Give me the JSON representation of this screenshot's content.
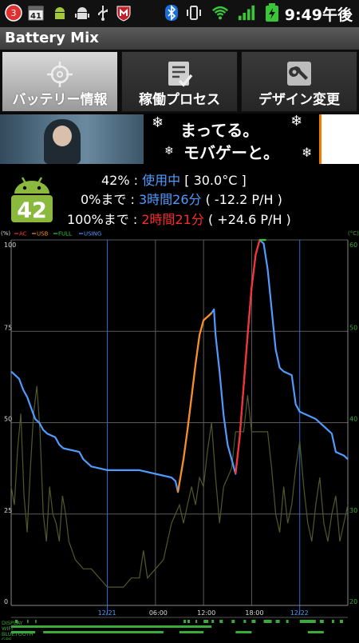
{
  "status_bar": {
    "time": "9:49午後",
    "notification_count": "3",
    "calendar_day": "41",
    "icons": [
      "notification-badge",
      "calendar",
      "android-robot",
      "android-robot",
      "usb",
      "mcafee-shield",
      "bluetooth",
      "vibrate",
      "wifi",
      "signal-bars",
      "battery-charging"
    ]
  },
  "app": {
    "title": "Battery Mix"
  },
  "tabs": [
    {
      "label": "バッテリー情報",
      "icon": "crosshair-icon",
      "active": true
    },
    {
      "label": "稼働プロセス",
      "icon": "checklist-icon",
      "active": false
    },
    {
      "label": "デザイン変更",
      "icon": "wrench-icon",
      "active": false
    }
  ],
  "banner": {
    "line1": "まってる。",
    "line2": "モバゲーと。"
  },
  "battery": {
    "level": "42",
    "percent_text": "42%",
    "sep": " : ",
    "status": "使用中",
    "temp": "[ 30.0°C ]",
    "to_empty_label": "0%まで",
    "to_empty_time": "3時間26分",
    "to_empty_rate": "( -12.2 P/H )",
    "to_full_label": "100%まで",
    "to_full_time": "2時間21分",
    "to_full_rate": "( +24.6 P/H )"
  },
  "colors": {
    "blue": "#4f9bff",
    "red": "#ff2b2b",
    "orange": "#ff8c1a",
    "green": "#5cd05c",
    "temp_line": "#4f5a2a",
    "android_green": "#8ab93d"
  },
  "chart_data": {
    "type": "line",
    "legend": [
      "AC",
      "USB",
      "FULL",
      "USING"
    ],
    "legend_colors": [
      "#ff3030",
      "#ff8c1a",
      "#33cc33",
      "#4f9bff"
    ],
    "left_axis": {
      "label": "(%)",
      "ticks": [
        "100",
        "75",
        "50",
        "25",
        "0"
      ],
      "range": [
        0,
        100
      ]
    },
    "right_axis": {
      "label": "(°C)",
      "ticks": [
        "60",
        "50",
        "40",
        "30",
        "20"
      ],
      "range": [
        20,
        60
      ]
    },
    "x_labels": [
      "12/21",
      "06:00",
      "12:00",
      "18:00",
      "12/22"
    ],
    "x_range_hours": [
      -12,
      30
    ],
    "series": [
      {
        "name": "USING",
        "color": "#4f9bff",
        "points": [
          [
            -12,
            64
          ],
          [
            -11.5,
            63
          ],
          [
            -11,
            62
          ],
          [
            -10.5,
            59
          ],
          [
            -10,
            57
          ],
          [
            -9.5,
            54
          ],
          [
            -9,
            51
          ],
          [
            -8.5,
            50
          ],
          [
            -8,
            48
          ],
          [
            -7.5,
            47
          ],
          [
            -6.5,
            46
          ],
          [
            -6,
            44
          ],
          [
            -5.5,
            43
          ],
          [
            -3.5,
            42
          ],
          [
            -3,
            40
          ],
          [
            -2.5,
            39
          ],
          [
            -2,
            38
          ],
          [
            0,
            37
          ],
          [
            4,
            37
          ],
          [
            6,
            36
          ],
          [
            8,
            35
          ],
          [
            8.5,
            34
          ],
          [
            8.8,
            31
          ],
          [
            9.5,
            40
          ],
          [
            10,
            48
          ],
          [
            10.5,
            57
          ],
          [
            11,
            66
          ],
          [
            11.5,
            74
          ],
          [
            12,
            78
          ],
          [
            12.5,
            79
          ],
          [
            13,
            80
          ],
          [
            13.3,
            81
          ],
          [
            13.5,
            74
          ],
          [
            14,
            64
          ],
          [
            14.5,
            52
          ],
          [
            15,
            44
          ],
          [
            15.5,
            40
          ],
          [
            16,
            36
          ],
          [
            16.5,
            46
          ],
          [
            17,
            60
          ],
          [
            17.5,
            74
          ],
          [
            18,
            87
          ],
          [
            18.5,
            96
          ],
          [
            19,
            100
          ],
          [
            19.5,
            99
          ],
          [
            20,
            92
          ],
          [
            20.5,
            81
          ],
          [
            21,
            70
          ],
          [
            21.5,
            65
          ],
          [
            22,
            64
          ],
          [
            23,
            63
          ],
          [
            23.5,
            55
          ],
          [
            24,
            53
          ],
          [
            25,
            52
          ],
          [
            26,
            51
          ],
          [
            27,
            49
          ],
          [
            27.5,
            48
          ],
          [
            28,
            47
          ],
          [
            28.5,
            42
          ],
          [
            29.5,
            41
          ],
          [
            30,
            40
          ]
        ]
      },
      {
        "name": "USB",
        "color": "#ff8c1a",
        "points": [
          [
            8.8,
            31
          ],
          [
            9.5,
            40
          ],
          [
            10,
            48
          ],
          [
            10.5,
            57
          ],
          [
            11,
            66
          ],
          [
            11.5,
            74
          ],
          [
            12,
            78
          ],
          [
            12.5,
            79
          ],
          [
            13,
            80
          ]
        ]
      },
      {
        "name": "AC",
        "color": "#ff3030",
        "points": [
          [
            16,
            36
          ],
          [
            16.5,
            46
          ],
          [
            17,
            60
          ],
          [
            17.5,
            74
          ],
          [
            18,
            87
          ],
          [
            18.5,
            96
          ],
          [
            19,
            100
          ]
        ]
      },
      {
        "name": "FULL",
        "color": "#33cc33",
        "points": [
          [
            19,
            100
          ],
          [
            19.8,
            100
          ]
        ]
      },
      {
        "name": "temperature",
        "color": "#4f5a2a",
        "points": [
          [
            -12,
            33
          ],
          [
            -11.6,
            31
          ],
          [
            -11.2,
            37
          ],
          [
            -10.8,
            41
          ],
          [
            -10.4,
            32
          ],
          [
            -10,
            28
          ],
          [
            -9.6,
            35
          ],
          [
            -9.2,
            41
          ],
          [
            -8.8,
            44
          ],
          [
            -8.4,
            39
          ],
          [
            -8,
            30
          ],
          [
            -7.6,
            27
          ],
          [
            -7.2,
            33
          ],
          [
            -6.8,
            30
          ],
          [
            -6.4,
            29
          ],
          [
            -6,
            27
          ],
          [
            -5.6,
            32
          ],
          [
            -5.2,
            30
          ],
          [
            -4.8,
            27
          ],
          [
            -4.4,
            26
          ],
          [
            -4,
            25
          ],
          [
            -3,
            24
          ],
          [
            -2,
            24
          ],
          [
            -1,
            23
          ],
          [
            0,
            22
          ],
          [
            1,
            22
          ],
          [
            2,
            22
          ],
          [
            3,
            23
          ],
          [
            4,
            23
          ],
          [
            4.5,
            26
          ],
          [
            5,
            23
          ],
          [
            6,
            24
          ],
          [
            7,
            25
          ],
          [
            7.5,
            27
          ],
          [
            8,
            29
          ],
          [
            8.5,
            30
          ],
          [
            9,
            31
          ],
          [
            9.5,
            29
          ],
          [
            10,
            31
          ],
          [
            10.5,
            33
          ],
          [
            11,
            31
          ],
          [
            11.5,
            34
          ],
          [
            12,
            33
          ],
          [
            12.5,
            37
          ],
          [
            13,
            40
          ],
          [
            13.5,
            34
          ],
          [
            14,
            29
          ],
          [
            14.5,
            33
          ],
          [
            15,
            34
          ],
          [
            15.5,
            35
          ],
          [
            16,
            39
          ],
          [
            16.5,
            39
          ],
          [
            17,
            39
          ],
          [
            17.5,
            43
          ],
          [
            18,
            39
          ],
          [
            19,
            39
          ],
          [
            20,
            39
          ],
          [
            20.5,
            35
          ],
          [
            21,
            30
          ],
          [
            21.5,
            28
          ],
          [
            22,
            33
          ],
          [
            22.5,
            29
          ],
          [
            23,
            31
          ],
          [
            23.5,
            35
          ],
          [
            24,
            38
          ],
          [
            24.5,
            33
          ],
          [
            25,
            29
          ],
          [
            25.5,
            27
          ],
          [
            26,
            31
          ],
          [
            26.5,
            34
          ],
          [
            27,
            29
          ],
          [
            27.5,
            27
          ],
          [
            28,
            30
          ],
          [
            28.5,
            32
          ],
          [
            29,
            27
          ],
          [
            29.5,
            29
          ],
          [
            30,
            31
          ]
        ]
      }
    ],
    "activity_rows": [
      {
        "label": "DISPLAY"
      },
      {
        "label": "WIFI"
      },
      {
        "label": "BLUETOOTH"
      },
      {
        "label": "GPS"
      }
    ]
  }
}
